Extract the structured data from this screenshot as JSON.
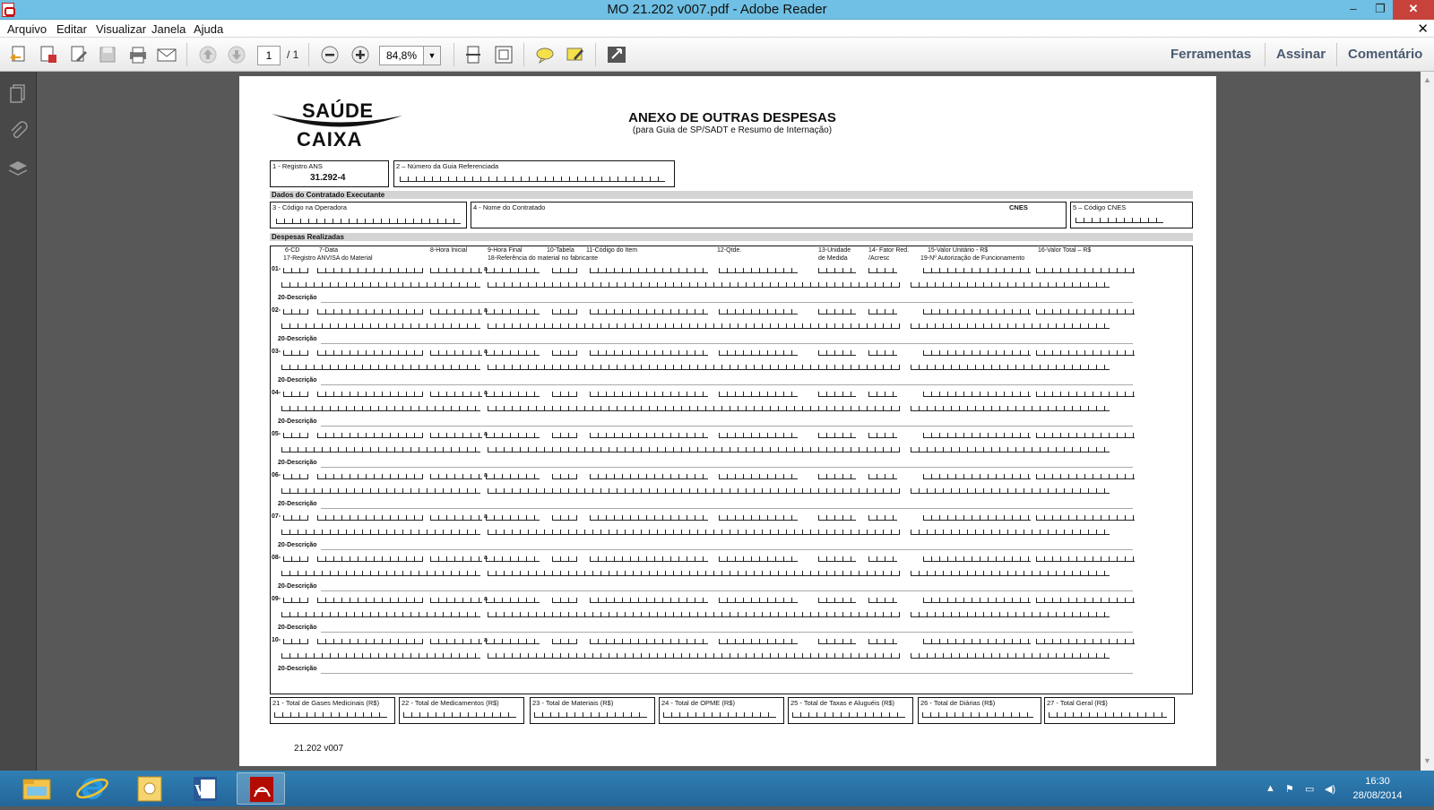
{
  "window": {
    "title": "MO 21.202 v007.pdf - Adobe Reader",
    "minimize": "–",
    "restore": "❐",
    "close": "✕"
  },
  "menu": {
    "items": [
      "Arquivo",
      "Editar",
      "Visualizar",
      "Janela",
      "Ajuda"
    ],
    "close": "✕"
  },
  "toolbar": {
    "page_current": "1",
    "page_total": "/ 1",
    "zoom": "84,8%",
    "right_links": [
      "Ferramentas",
      "Assinar",
      "Comentário"
    ]
  },
  "document": {
    "logo_top": "SAÚDE",
    "logo_bottom": "CAIXA",
    "title": "ANEXO  DE OUTRAS DESPESAS",
    "subtitle": "(para Guia de SP/SADT e Resumo de Internação)",
    "field1_label": "1 - Registro ANS",
    "field1_value": "31.292-4",
    "field2_label": "2 – Número da Guia Referenciada",
    "section_contratado": "Dados do Contratado Executante",
    "field3_label": "3 - Código na Operadora",
    "field4_label": "4 - Nome do Contratado",
    "cnes": "CNES",
    "field5_label": "5 – Código CNES",
    "section_despesas": "Despesas Realizadas",
    "col_headers": {
      "cd": "6-CD",
      "data": "7-Data",
      "hora_inicial": "8-Hora Inicial",
      "hora_final": "9-Hora Final",
      "tabela": "10-Tabela",
      "codigo_item": "11-Código do Item",
      "qtde": "12-Qtde.",
      "unidade": "13-Unidade",
      "unidade2": "de Medida",
      "fator": "14- Fator Red.",
      "fator2": "/Acresc",
      "valor_unitario": "15-Valor Unitário - R$",
      "valor_total": "16-Valor Total – R$",
      "anvisa": "17-Registro ANVISA do Material",
      "referencia": "18-Referência do material no fabricante",
      "autorizacao": "19-Nº Autorização de Funcionamento"
    },
    "row_numbers": [
      "01-",
      "02-",
      "03-",
      "04-",
      "05-",
      "06-",
      "07-",
      "08-",
      "09-",
      "10-"
    ],
    "desc_label": "20-Descrição",
    "a_label": "a",
    "totals": [
      "21 - Total de Gases Medicinais (R$)",
      "22 - Total de Medicamentos (R$)",
      "23 - Total de Materiais (R$)",
      "24 - Total de OPME (R$)",
      "25 - Total de Taxas e Aluguéis (R$)",
      "26 - Total de Diárias (R$)",
      "27 - Total Geral (R$)"
    ],
    "version": "21.202 v007"
  },
  "taskbar": {
    "time": "16:30",
    "date": "28/08/2014"
  }
}
